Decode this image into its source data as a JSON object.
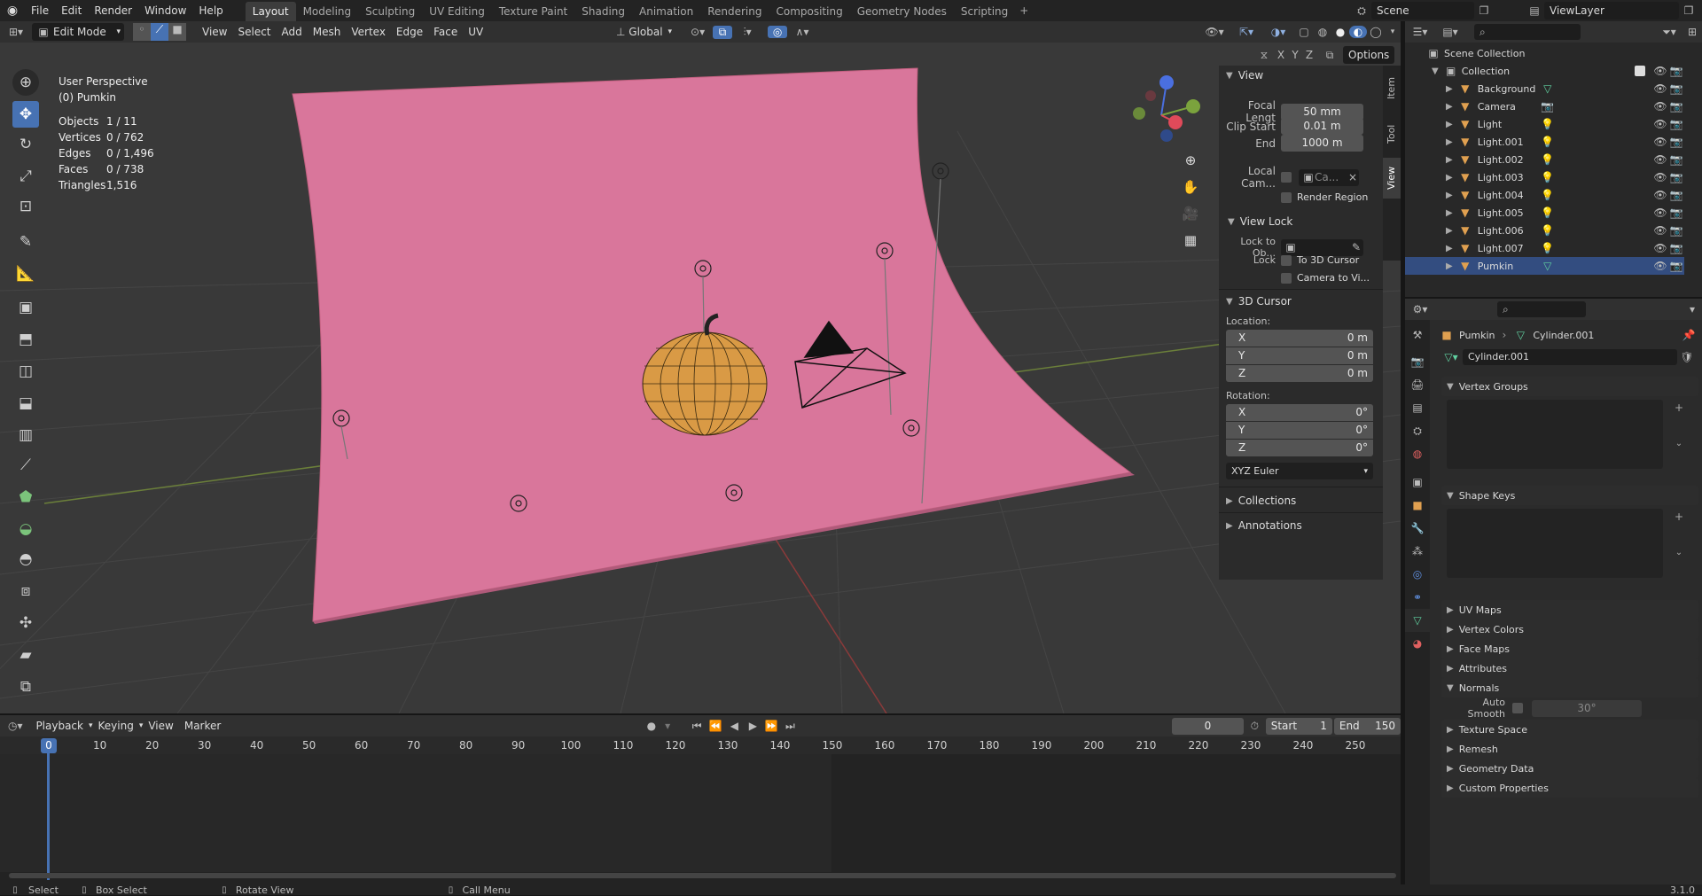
{
  "menu": {
    "items": [
      "File",
      "Edit",
      "Render",
      "Window",
      "Help"
    ]
  },
  "workspaces": {
    "tabs": [
      "Layout",
      "Modeling",
      "Sculpting",
      "UV Editing",
      "Texture Paint",
      "Shading",
      "Animation",
      "Rendering",
      "Compositing",
      "Geometry Nodes",
      "Scripting"
    ],
    "active": "Layout"
  },
  "top_right": {
    "scene": "Scene",
    "view_layer": "ViewLayer"
  },
  "viewport_header": {
    "mode": "Edit Mode",
    "menus": [
      "View",
      "Select",
      "Add",
      "Mesh",
      "Vertex",
      "Edge",
      "Face",
      "UV"
    ],
    "orientation": "Global",
    "options": "Options",
    "axes": [
      "X",
      "Y",
      "Z"
    ]
  },
  "overlay": {
    "title": "User Perspective",
    "subtitle": "(0) Pumkin",
    "stats": [
      {
        "label": "Objects",
        "value": "1 / 11"
      },
      {
        "label": "Vertices",
        "value": "0 / 762"
      },
      {
        "label": "Edges",
        "value": "0 / 1,496"
      },
      {
        "label": "Faces",
        "value": "0 / 738"
      },
      {
        "label": "Triangles",
        "value": "1,516"
      }
    ]
  },
  "sidebar": {
    "tabs": [
      "Item",
      "Tool",
      "View"
    ],
    "view": {
      "title": "View",
      "focal_label": "Focal Lengt",
      "focal": "50 mm",
      "clip_start_label": "Clip Start",
      "clip_start": "0.01 m",
      "end_label": "End",
      "end": "1000 m",
      "local_cam_label": "Local Cam...",
      "local_cam_value": "Ca...",
      "render_region": "Render Region"
    },
    "view_lock": {
      "title": "View Lock",
      "lock_to_obj": "Lock to Ob...",
      "lock": "Lock",
      "to_3d_cursor": "To 3D Cursor",
      "camera_to_view": "Camera to Vi..."
    },
    "cursor": {
      "title": "3D Cursor",
      "location": "Location:",
      "x": "0 m",
      "y": "0 m",
      "z": "0 m",
      "rotation": "Rotation:",
      "rx": "0°",
      "ry": "0°",
      "rz": "0°",
      "axis_x": "X",
      "axis_y": "Y",
      "axis_z": "Z",
      "mode": "XYZ Euler"
    },
    "collections": "Collections",
    "annotations": "Annotations"
  },
  "outliner": {
    "root": "Scene Collection",
    "collection": "Collection",
    "items": [
      {
        "name": "Background",
        "type": "mesh"
      },
      {
        "name": "Camera",
        "type": "camera"
      },
      {
        "name": "Light",
        "type": "light"
      },
      {
        "name": "Light.001",
        "type": "light"
      },
      {
        "name": "Light.002",
        "type": "light"
      },
      {
        "name": "Light.003",
        "type": "light"
      },
      {
        "name": "Light.004",
        "type": "light"
      },
      {
        "name": "Light.005",
        "type": "light"
      },
      {
        "name": "Light.006",
        "type": "light"
      },
      {
        "name": "Light.007",
        "type": "light"
      },
      {
        "name": "Pumkin",
        "type": "mesh",
        "selected": true
      }
    ]
  },
  "properties": {
    "breadcrumb_object": "Pumkin",
    "breadcrumb_data": "Cylinder.001",
    "datablock": "Cylinder.001",
    "sections": [
      {
        "name": "Vertex Groups",
        "open": true
      },
      {
        "name": "Shape Keys",
        "open": true
      },
      {
        "name": "UV Maps",
        "open": false
      },
      {
        "name": "Vertex Colors",
        "open": false
      },
      {
        "name": "Face Maps",
        "open": false
      },
      {
        "name": "Attributes",
        "open": false
      },
      {
        "name": "Normals",
        "open": true
      },
      {
        "name": "Texture Space",
        "open": false
      },
      {
        "name": "Remesh",
        "open": false
      },
      {
        "name": "Geometry Data",
        "open": false
      },
      {
        "name": "Custom Properties",
        "open": false
      }
    ],
    "auto_smooth": "Auto Smooth",
    "angle": "30°"
  },
  "timeline": {
    "menus": [
      "Playback",
      "Keying",
      "View",
      "Marker"
    ],
    "current": "0",
    "start_label": "Start",
    "start": "1",
    "end_label": "End",
    "end": "150",
    "ticks": [
      "0",
      "10",
      "20",
      "30",
      "40",
      "50",
      "60",
      "70",
      "80",
      "90",
      "100",
      "110",
      "120",
      "130",
      "140",
      "150",
      "160",
      "170",
      "180",
      "190",
      "200",
      "210",
      "220",
      "230",
      "240",
      "250"
    ]
  },
  "statusbar": {
    "select": "Select",
    "box_select": "Box Select",
    "rotate_view": "Rotate View",
    "call_menu": "Call Menu",
    "version": "3.1.0"
  },
  "colors": {
    "accent": "#4772b3",
    "backdrop": "#d9769b",
    "pumpkin": "#d99a45",
    "selected_row": "#334d80"
  }
}
